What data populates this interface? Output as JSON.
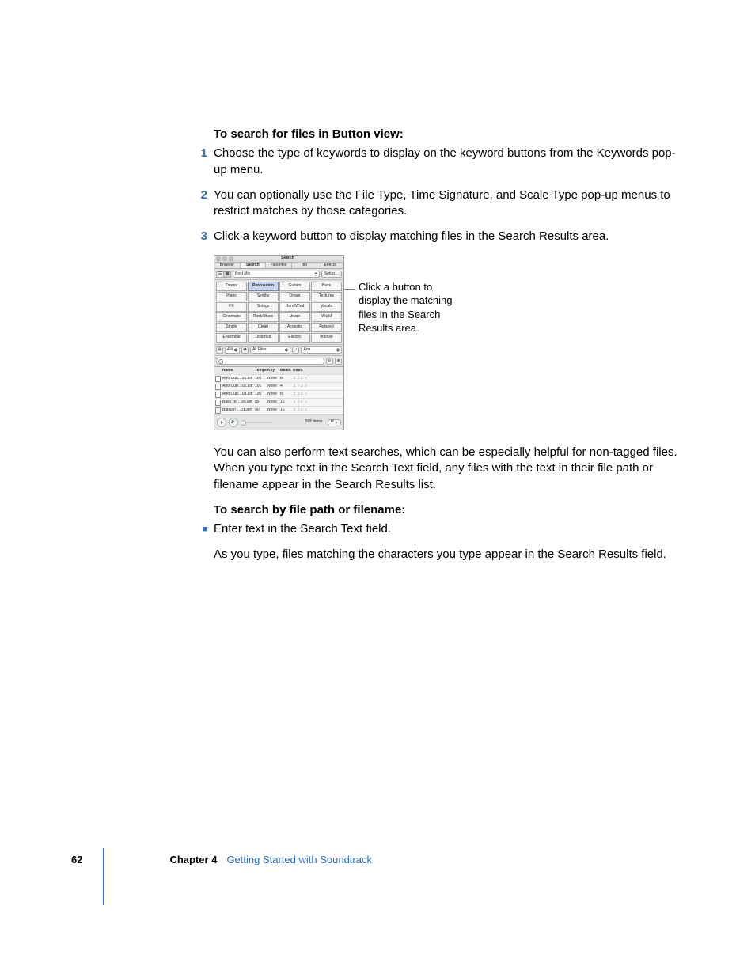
{
  "section1_heading": "To search for files in Button view:",
  "steps": {
    "s1": {
      "num": "1",
      "text": "Choose the type of keywords to display on the keyword buttons from the Keywords pop-up menu."
    },
    "s2": {
      "num": "2",
      "text": "You can optionally use the File Type, Time Signature, and Scale Type pop-up menus to restrict matches by those categories."
    },
    "s3": {
      "num": "3",
      "text": "Click a keyword button to display matching files in the Search Results area."
    }
  },
  "callout_text": "Click a button to display the matching files in the Search Results area.",
  "para_after_figure": "You can also perform text searches, which can be especially helpful for non-tagged files. When you type text in the Search Text field, any files with the text in their file path or filename appear in the Search Results list.",
  "section2_heading": "To search by file path or filename:",
  "bullet1": "Enter text in the Search Text field.",
  "para_final": "As you type, files matching the characters you type appear in the Search Results field.",
  "footer": {
    "page": "62",
    "chapter_label": "Chapter 4",
    "chapter_name": "Getting Started with Soundtrack"
  },
  "ui": {
    "title": "Search",
    "tabs": [
      "Browser",
      "Search",
      "Favorites",
      "Bin",
      "Effects"
    ],
    "keywords_popup": "Best Mix",
    "setup_label": "Setup…",
    "keyword_grid": [
      "Drums",
      "Percussion",
      "Guitars",
      "Bass",
      "Piano",
      "Synths",
      "Organ",
      "Textures",
      "FX",
      "Strings",
      "Horn/Wind",
      "Vocals",
      "Cinematic",
      "Rock/Blues",
      "Urban",
      "World",
      "Single",
      "Clean",
      "Acoustic",
      "Relaxed",
      "Ensemble",
      "Distorted",
      "Electric",
      "Intense"
    ],
    "selected_keyword_index": 1,
    "filters": {
      "timesig": "4/4",
      "filetype": "All Files",
      "scale": "Any"
    },
    "columns": [
      "",
      "Name",
      "Tempo",
      "Key",
      "Beats",
      "Hints"
    ],
    "rows": [
      {
        "name": "Afro Cub…01.aiff",
        "tempo": "110",
        "key": "None",
        "beats": "8"
      },
      {
        "name": "Afro Cub…02.aiff",
        "tempo": "101",
        "key": "None",
        "beats": "4"
      },
      {
        "name": "Afro Cub…03.aiff",
        "tempo": "130",
        "key": "None",
        "beats": "8"
      },
      {
        "name": "Bass Ter…es.aiff",
        "tempo": "85",
        "key": "None",
        "beats": "16"
      },
      {
        "name": "Batajon …01.aiff",
        "tempo": "90",
        "key": "None",
        "beats": "16"
      }
    ],
    "hints_glyph": "♫ ♪♫ ♪",
    "item_count": "505 items"
  }
}
